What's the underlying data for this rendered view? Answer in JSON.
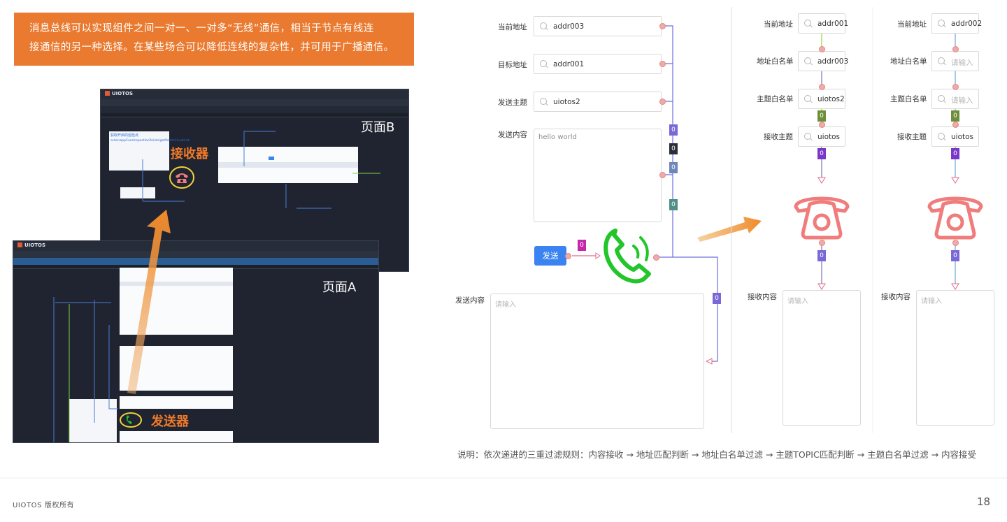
{
  "banner": {
    "line1": "消息总线可以实现组件之间一对一、一对多“无线”通信，相当于节点有线连",
    "line2": "接通信的另一种选择。在某些场合可以降低连线的复杂性，并可用于广播通信。"
  },
  "screenshot_b": {
    "brand": "UIOTOS",
    "page_label": "页面B",
    "receiver_label": "接收器",
    "api_title": "获取开启的巡检点",
    "api_path": "order/appCoreInspectionPoints/getPointsCountList"
  },
  "screenshot_a": {
    "brand": "UIOTOS",
    "page_label": "页面A",
    "sender_label": "发送器"
  },
  "sender_panel": {
    "current_address_label": "当前地址",
    "current_address_value": "addr003",
    "target_address_label": "目标地址",
    "target_address_value": "addr001",
    "send_topic_label": "发送主题",
    "send_topic_value": "uiotos2",
    "send_content_label": "发送内容",
    "send_content_value": "hello world",
    "send_button": "发送",
    "bottom_content_label": "发送内容",
    "bottom_content_placeholder": "请输入"
  },
  "receiver1": {
    "current_address_label": "当前地址",
    "current_address_value": "addr001",
    "whitelist_label": "地址白名单",
    "whitelist_value": "addr003",
    "topic_whitelist_label": "主题白名单",
    "topic_whitelist_value": "uiotos2",
    "receive_topic_label": "接收主题",
    "receive_topic_value": "uiotos",
    "receive_content_label": "接收内容",
    "receive_content_placeholder": "请输入"
  },
  "receiver2": {
    "current_address_label": "当前地址",
    "current_address_value": "addr002",
    "whitelist_label": "地址白名单",
    "whitelist_placeholder": "请输入",
    "topic_whitelist_label": "主题白名单",
    "topic_whitelist_placeholder": "请输入",
    "receive_topic_label": "接收主题",
    "receive_topic_value": "uiotos",
    "receive_content_label": "接收内容",
    "receive_content_placeholder": "请输入"
  },
  "tags": {
    "zero": "0"
  },
  "description": "说明：依次递进的三重过滤规则：内容接收 → 地址匹配判断 → 地址白名单过滤 → 主题TOPIC匹配判断 → 主题白名单过滤 → 内容接受",
  "footer": {
    "copyright": "UIOTOS 版权所有",
    "page_number": "18"
  },
  "colors": {
    "banner": "#ea7a2f",
    "phone_green": "#22c52a",
    "phone_red": "#f07c7c",
    "button_blue": "#3a83f0",
    "tag_purple": "#7a68d8",
    "tag_green": "#6e8f3a"
  }
}
